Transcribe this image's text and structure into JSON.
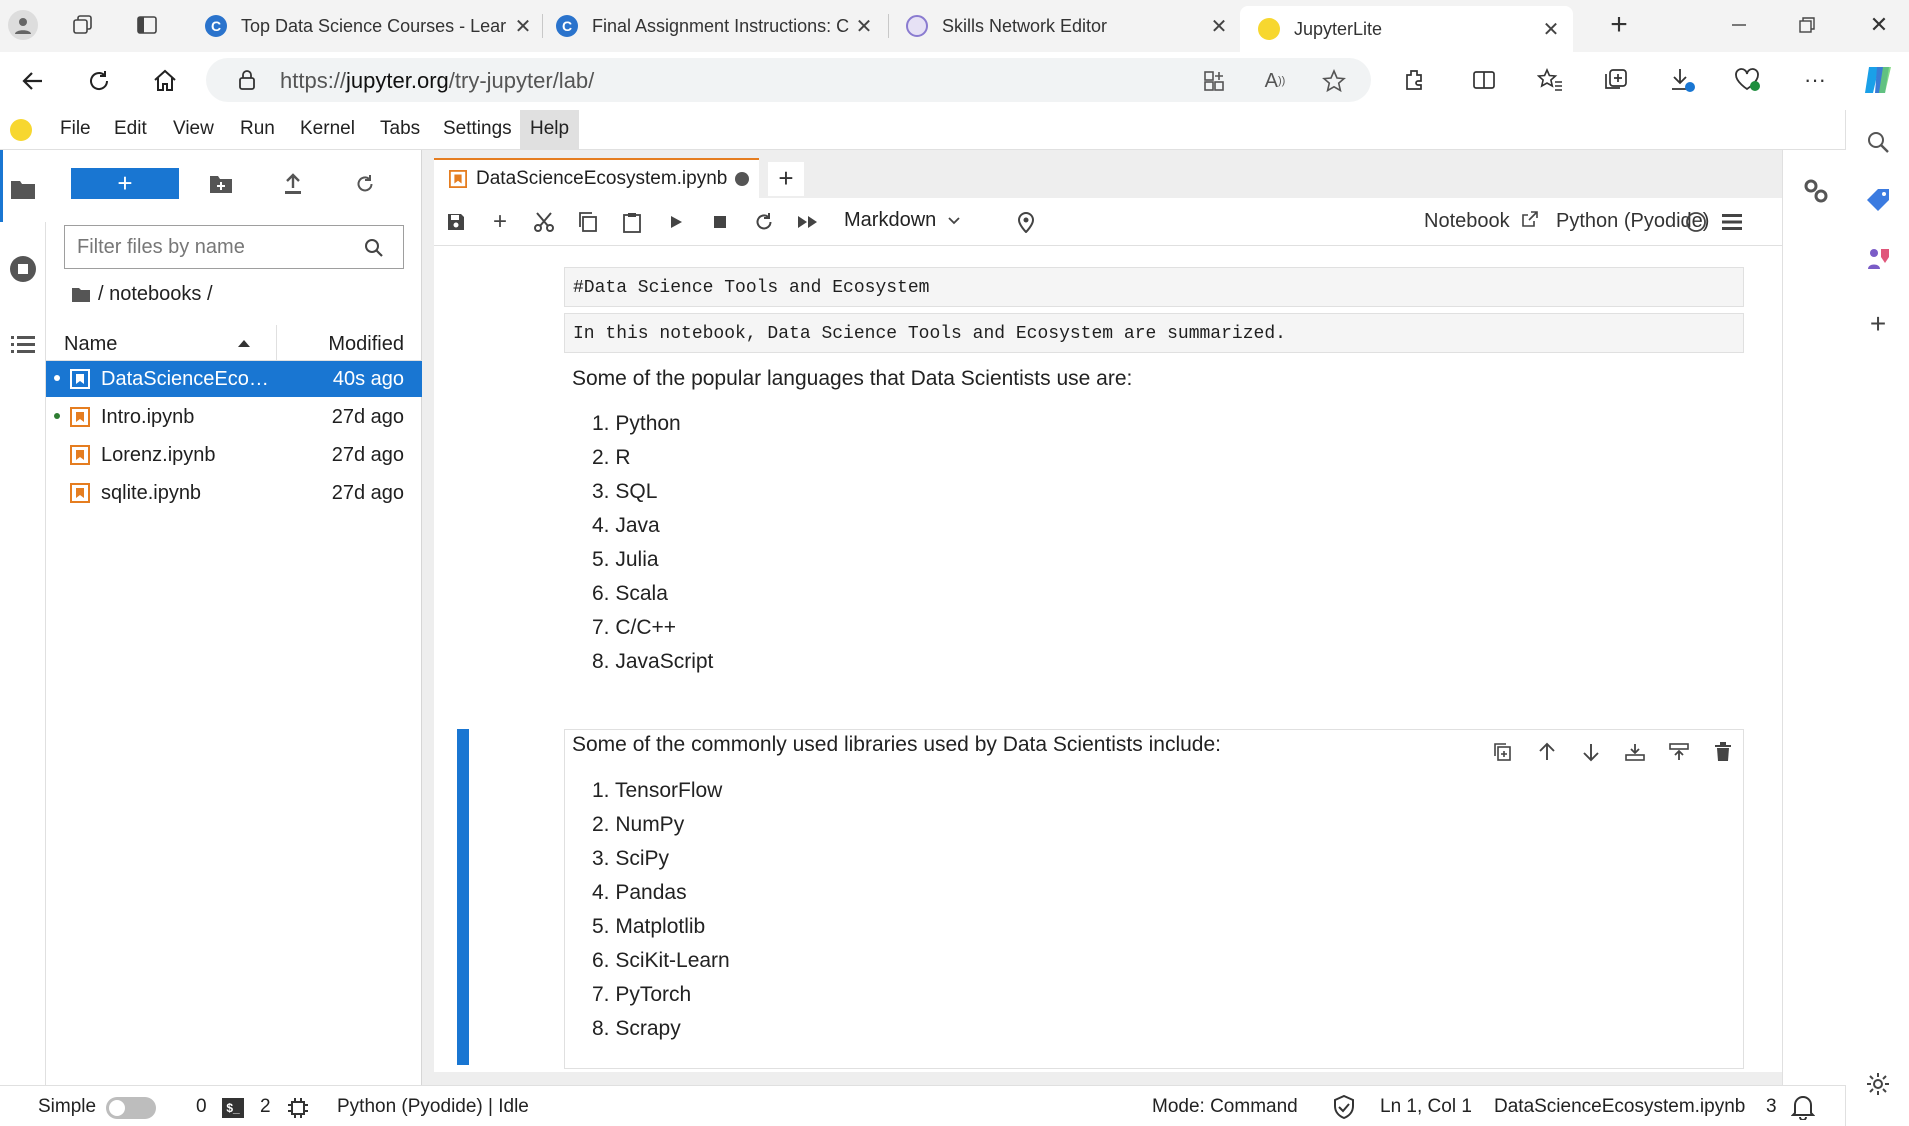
{
  "browser": {
    "tabs": [
      {
        "title": "Top Data Science Courses - Lear",
        "icon": "coursera-icon"
      },
      {
        "title": "Final Assignment Instructions: C",
        "icon": "coursera-icon"
      },
      {
        "title": "Skills Network Editor",
        "icon": "skills-network-icon"
      },
      {
        "title": "JupyterLite",
        "icon": "jupyter-icon"
      }
    ],
    "url_scheme": "https://",
    "url_host": "jupyter.org",
    "url_path": "/try-jupyter/lab/"
  },
  "menu": [
    "File",
    "Edit",
    "View",
    "Run",
    "Kernel",
    "Tabs",
    "Settings",
    "Help"
  ],
  "filebrowser": {
    "new_label": "+",
    "filter_placeholder": "Filter files by name",
    "breadcrumb": "/ notebooks /",
    "col_name": "Name",
    "col_modified": "Modified",
    "files": [
      {
        "name": "DataScienceEcosy...",
        "modified": "40s ago",
        "selected": true,
        "running": true
      },
      {
        "name": "Intro.ipynb",
        "modified": "27d ago",
        "selected": false,
        "running": true
      },
      {
        "name": "Lorenz.ipynb",
        "modified": "27d ago",
        "selected": false,
        "running": false
      },
      {
        "name": "sqlite.ipynb",
        "modified": "27d ago",
        "selected": false,
        "running": false
      }
    ]
  },
  "notebook": {
    "tab_title": "DataScienceEcosystem.ipynb",
    "cell_type": "Markdown",
    "notebook_link": "Notebook",
    "kernel": "Python (Pyodide)",
    "raw_cells": [
      "#Data Science Tools and Ecosystem",
      "In this notebook, Data Science Tools and Ecosystem are summarized."
    ],
    "languages_intro": "Some of the popular languages that Data Scientists use are:",
    "languages": [
      "1. Python",
      "2. R",
      "3. SQL",
      "4. Java",
      "5. Julia",
      "6. Scala",
      "7. C/C++",
      "8. JavaScript"
    ],
    "libraries_intro": "Some of the commonly used libraries used by Data Scientists include:",
    "libraries": [
      "1. TensorFlow",
      "2. NumPy",
      "3. SciPy",
      "4. Pandas",
      "5. Matplotlib",
      "6. SciKit-Learn",
      "7. PyTorch",
      "8. Scrapy"
    ]
  },
  "status": {
    "mode_simple": "Simple",
    "terminals": "0",
    "kernels": "2",
    "kernel_status": "Python (Pyodide) | Idle",
    "mode": "Mode: Command",
    "position": "Ln 1, Col 1",
    "file": "DataScienceEcosystem.ipynb",
    "notifications": "3"
  },
  "colors": {
    "accent": "#1976d2",
    "notebook_orange": "#e57d20"
  }
}
